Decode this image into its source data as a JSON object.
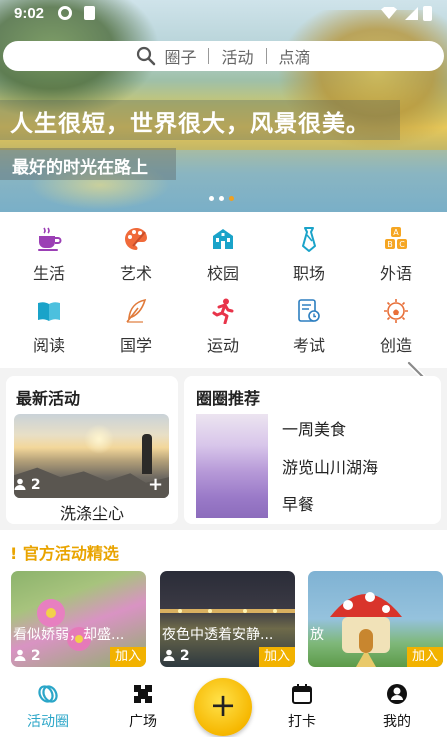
{
  "status_bar": {
    "time": "9:02"
  },
  "search": {
    "tab1": "圈子",
    "tab2": "活动",
    "tab3": "点滴"
  },
  "banner": {
    "headline": "人生很短，世界很大，风景很美。",
    "subline": "最好的时光在路上",
    "dots": 3,
    "active_dot": 3
  },
  "categories": [
    {
      "label": "生活",
      "icon": "coffee-cup-icon",
      "color": "#9b3fb5"
    },
    {
      "label": "艺术",
      "icon": "palette-icon",
      "color": "#f06a3a"
    },
    {
      "label": "校园",
      "icon": "school-building-icon",
      "color": "#1aa3c9"
    },
    {
      "label": "职场",
      "icon": "necktie-icon",
      "color": "#1aa3c9"
    },
    {
      "label": "外语",
      "icon": "abc-blocks-icon",
      "color": "#f5a623"
    },
    {
      "label": "阅读",
      "icon": "open-book-icon",
      "color": "#1aa3c9"
    },
    {
      "label": "国学",
      "icon": "feather-quill-icon",
      "color": "#e07a3a"
    },
    {
      "label": "运动",
      "icon": "running-person-icon",
      "color": "#e8344a"
    },
    {
      "label": "考试",
      "icon": "exam-paper-icon",
      "color": "#2d7fc0"
    },
    {
      "label": "创造",
      "icon": "lightbulb-gear-icon",
      "color": "#e8703a"
    }
  ],
  "latest_activity": {
    "title": "最新活动",
    "count": "2",
    "caption": "洗涤尘心"
  },
  "recommend": {
    "title": "圈圈推荐",
    "items": [
      "一周美食",
      "游览山川湖海",
      "早餐"
    ]
  },
  "official": {
    "title": "官方活动精选",
    "tiles": [
      {
        "caption": "看似娇弱，却盛...",
        "count": "2",
        "join": "加入"
      },
      {
        "caption": "夜色中透着安静...",
        "count": "2",
        "join": "加入"
      },
      {
        "caption": "放",
        "count": "",
        "join": "加入"
      }
    ]
  },
  "nav": {
    "items": [
      {
        "label": "活动圈",
        "active": true
      },
      {
        "label": "广场",
        "active": false
      },
      {
        "label": "打卡",
        "active": false
      },
      {
        "label": "我的",
        "active": false
      }
    ],
    "fab": "+"
  }
}
